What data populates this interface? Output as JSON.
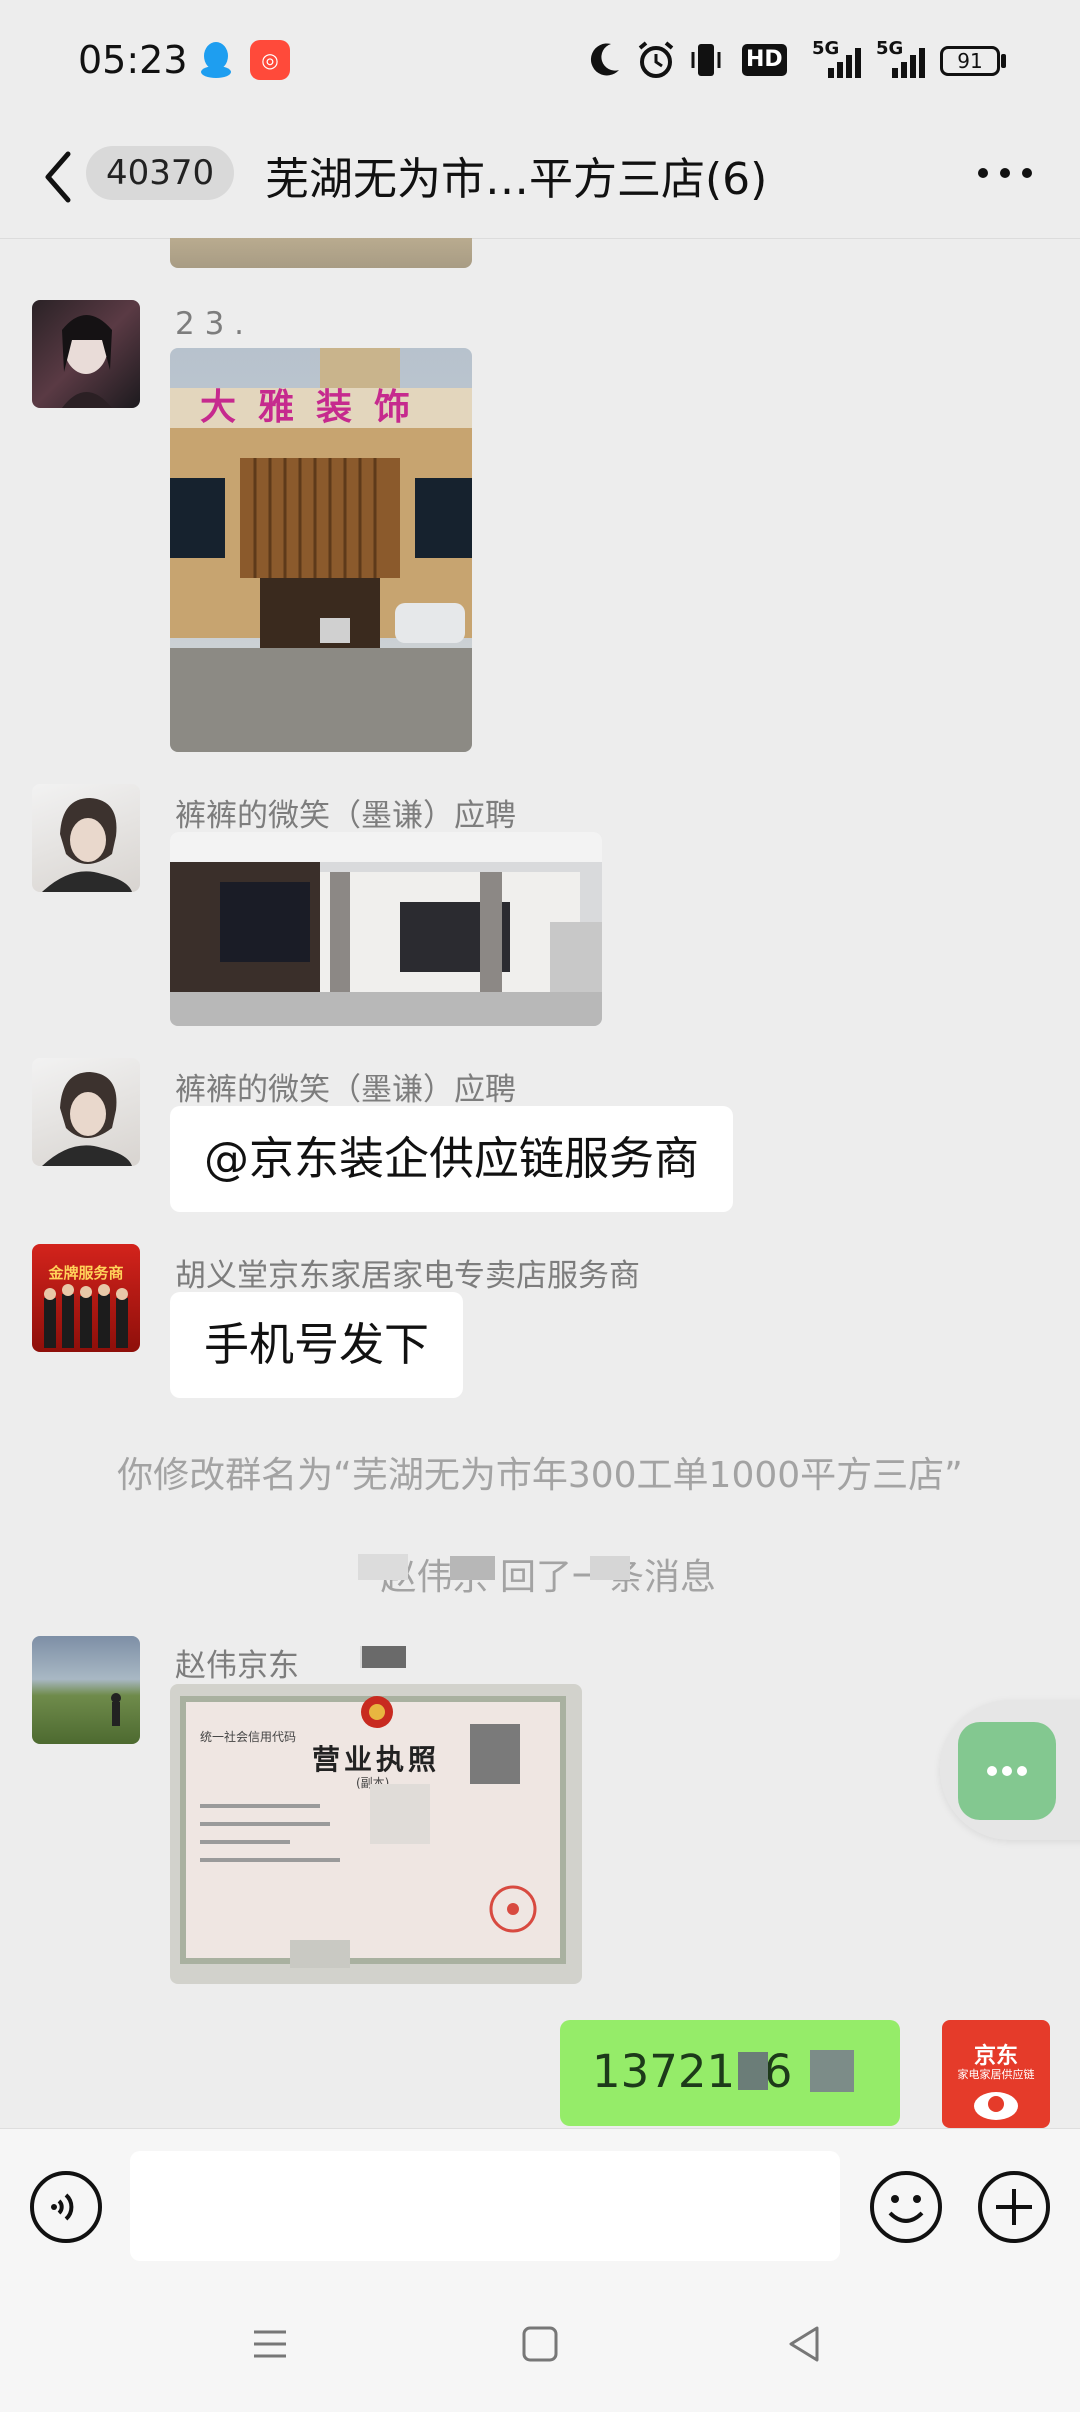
{
  "status_bar": {
    "time": "05:23",
    "battery": "91",
    "hd_label": "HD",
    "signal_label_1": "5G",
    "signal_label_2": "5G"
  },
  "header": {
    "unread_count": "40370",
    "title": "芜湖无为市…平方三店(6)"
  },
  "messages": [
    {
      "sender": "2 3 .",
      "type": "image",
      "image_sign": "大雅装饰"
    },
    {
      "sender": "裤裤的微笑（墨谦）应聘",
      "type": "image"
    },
    {
      "sender": "裤裤的微笑（墨谦）应聘",
      "type": "text",
      "text": "@京东装企供应链服务商"
    },
    {
      "sender": "胡义堂京东家居家电专卖店服务商",
      "type": "text",
      "text": "手机号发下",
      "avatar_label": "金牌服务商"
    },
    {
      "type": "system",
      "text": "你修改群名为“芜湖无为市年300工单1000平方三店”"
    },
    {
      "type": "system",
      "text": "\"赵伟京          回了一条消息"
    },
    {
      "sender": "赵伟京东",
      "type": "image",
      "doc_title": "营业执照",
      "doc_subtitle": "(副本)",
      "doc_label": "统一社会信用代码"
    },
    {
      "type": "outgoing",
      "text": "1372126",
      "avatar_brand": "京东",
      "avatar_sub": "家电家居供应链"
    }
  ],
  "colors": {
    "outgoing_bubble": "#95ec69",
    "floating_button": "#83c890",
    "background": "#ededed"
  }
}
